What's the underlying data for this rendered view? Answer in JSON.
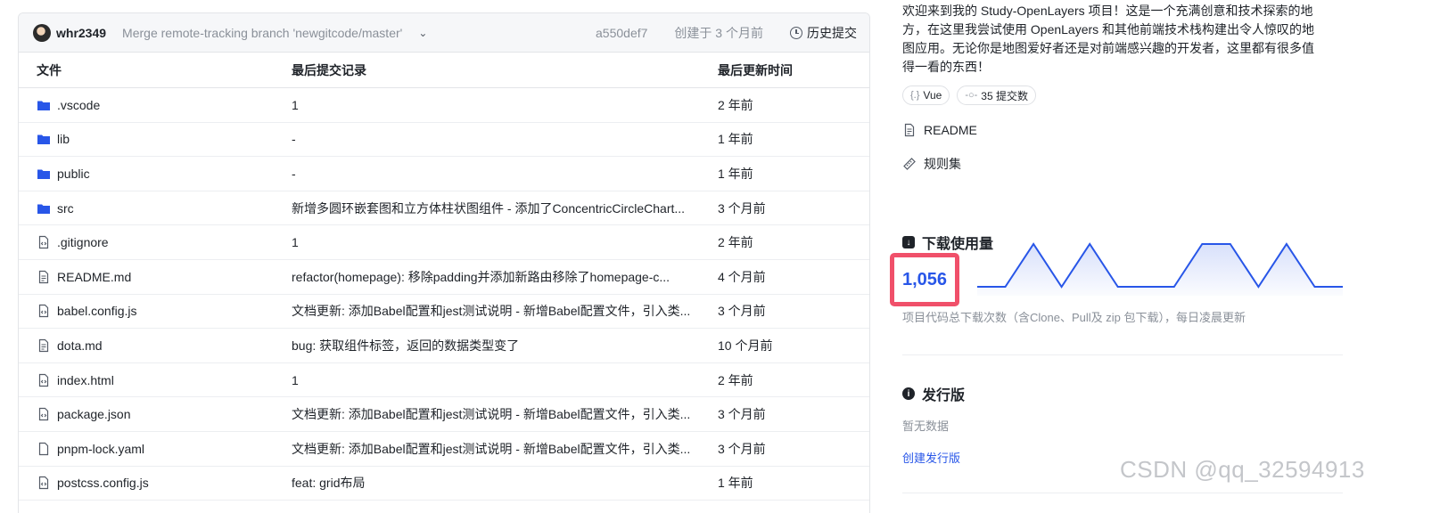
{
  "commit": {
    "author": "whr2349",
    "message": "Merge remote-tracking branch 'newgitcode/master'",
    "sha": "a550def7",
    "created": "创建于 3 个月前",
    "history_label": "历史提交"
  },
  "table": {
    "headers": [
      "文件",
      "最后提交记录",
      "最后更新时间"
    ],
    "rows": [
      {
        "icon": "folder-icon",
        "name": ".vscode",
        "commit": "1",
        "time": "2 年前"
      },
      {
        "icon": "folder-icon",
        "name": "lib",
        "commit": "-",
        "time": "1 年前"
      },
      {
        "icon": "folder-icon",
        "name": "public",
        "commit": "-",
        "time": "1 年前"
      },
      {
        "icon": "folder-icon",
        "name": "src",
        "commit": "新增多圆环嵌套图和立方体柱状图组件 - 添加了ConcentricCircleChart...",
        "time": "3 个月前"
      },
      {
        "icon": "code-file-icon",
        "name": ".gitignore",
        "commit": "1",
        "time": "2 年前"
      },
      {
        "icon": "text-file-icon",
        "name": "README.md",
        "commit": "refactor(homepage): 移除padding并添加新路由移除了homepage-c...",
        "time": "4 个月前"
      },
      {
        "icon": "code-file-icon",
        "name": "babel.config.js",
        "commit": "文档更新: 添加Babel配置和jest测试说明 - 新增Babel配置文件，引入类...",
        "time": "3 个月前"
      },
      {
        "icon": "text-file-icon",
        "name": "dota.md",
        "commit": "bug: 获取组件标签，返回的数据类型变了",
        "time": "10 个月前"
      },
      {
        "icon": "code-file-icon",
        "name": "index.html",
        "commit": "1",
        "time": "2 年前"
      },
      {
        "icon": "code-file-icon",
        "name": "package.json",
        "commit": "文档更新: 添加Babel配置和jest测试说明 - 新增Babel配置文件，引入类...",
        "time": "3 个月前"
      },
      {
        "icon": "blank-file-icon",
        "name": "pnpm-lock.yaml",
        "commit": "文档更新: 添加Babel配置和jest测试说明 - 新增Babel配置文件，引入类...",
        "time": "3 个月前"
      },
      {
        "icon": "code-file-icon",
        "name": "postcss.config.js",
        "commit": "feat: grid布局",
        "time": "1 年前"
      }
    ]
  },
  "sidebar": {
    "description": "欢迎来到我的 Study-OpenLayers 项目！这是一个充满创意和技术探索的地方，在这里我尝试使用 OpenLayers 和其他前端技术栈构建出令人惊叹的地图应用。无论你是地图爱好者还是对前端感兴趣的开发者，这里都有很多值得一看的东西！",
    "tags": [
      {
        "icon": "{.}",
        "label": "Vue"
      },
      {
        "icon": "-○-",
        "label": "35 提交数"
      }
    ],
    "readme_label": "README",
    "rules_label": "规则集",
    "downloads": {
      "title": "下载使用量",
      "count": "1,056",
      "note": "项目代码总下载次数（含Clone、Pull及 zip 包下载），每日凌晨更新",
      "trend": [
        0,
        0,
        1,
        0,
        1,
        0,
        0,
        0,
        1,
        1,
        0,
        1,
        0,
        0
      ]
    },
    "releases": {
      "title": "发行版",
      "empty": "暂无数据",
      "create_link": "创建发行版"
    }
  },
  "watermark": "CSDN @qq_32594913",
  "colors": {
    "accent": "#2856e8",
    "highlight_border": "#f0506a",
    "folder": "#2856e8"
  }
}
